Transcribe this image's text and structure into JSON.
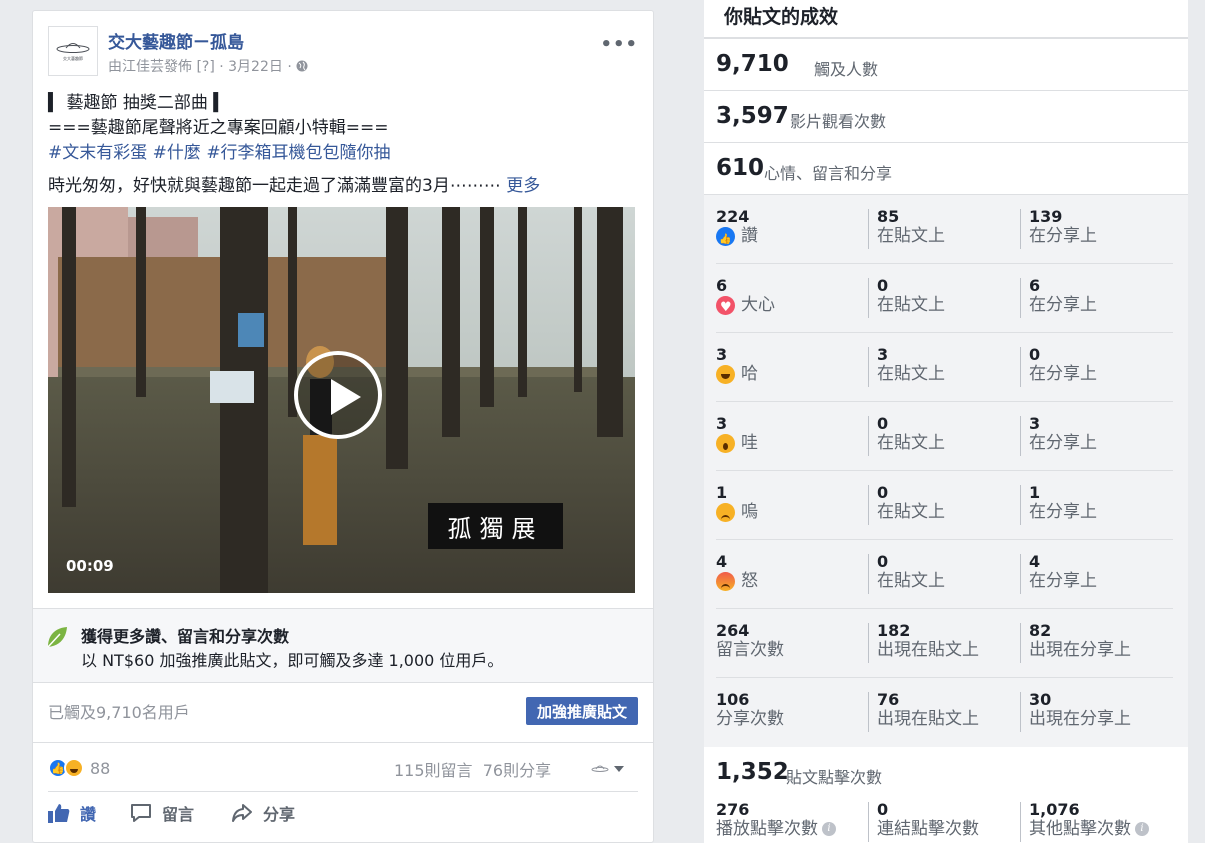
{
  "post": {
    "page_name": "交大藝趣節ㄧ孤島",
    "avatar_text": "交大藝趣節",
    "meta": "由江佳芸發佈 [?] · 3月22日 · ",
    "line1": "▍ 藝趣節 抽獎二部曲 ▍",
    "line2": "===藝趣節尾聲將近之專案回顧小特輯===",
    "hashtags": [
      "#文末有彩蛋",
      "#什麼",
      "#行李箱耳機包包隨你抽"
    ],
    "line4": "時光匆匆，好快就與藝趣節一起走過了滿滿豐富的3月⋯⋯⋯ ",
    "see_more": "更多",
    "video": {
      "time": "00:09",
      "caption": "孤獨展"
    },
    "boost_tip": {
      "title": "獲得更多讚、留言和分享次數",
      "text": "以 NT$60 加強推廣此貼文，即可觸及多達 1,000 位用戶。"
    },
    "reached": "已觸及9,710名用戶",
    "boost_button": "加強推廣貼文",
    "reaction_count": "88",
    "comments": "115則留言",
    "shares": "76則分享",
    "actions": {
      "like": "讚",
      "comment": "留言",
      "share": "分享"
    }
  },
  "insights": {
    "title": "你貼文的成效",
    "metrics": [
      {
        "num": "9,710",
        "label": "觸及人數"
      },
      {
        "num": "3,597",
        "label": "影片觀看次數"
      },
      {
        "num": "610",
        "label": "心情、留言和分享"
      }
    ],
    "rows": [
      {
        "icon": "like-icon",
        "total": "224",
        "label": "讚",
        "post": "85",
        "post_label": "在貼文上",
        "share": "139",
        "share_label": "在分享上"
      },
      {
        "icon": "love-icon",
        "total": "6",
        "label": "大心",
        "post": "0",
        "post_label": "在貼文上",
        "share": "6",
        "share_label": "在分享上"
      },
      {
        "icon": "haha-icon",
        "total": "3",
        "label": "哈",
        "post": "3",
        "post_label": "在貼文上",
        "share": "0",
        "share_label": "在分享上"
      },
      {
        "icon": "wow-icon",
        "total": "3",
        "label": "哇",
        "post": "0",
        "post_label": "在貼文上",
        "share": "3",
        "share_label": "在分享上"
      },
      {
        "icon": "sad-icon",
        "total": "1",
        "label": "嗚",
        "post": "0",
        "post_label": "在貼文上",
        "share": "1",
        "share_label": "在分享上"
      },
      {
        "icon": "angry-icon",
        "total": "4",
        "label": "怒",
        "post": "0",
        "post_label": "在貼文上",
        "share": "4",
        "share_label": "在分享上"
      },
      {
        "icon": "",
        "total": "264",
        "label": "留言次數",
        "post": "182",
        "post_label": "出現在貼文上",
        "share": "82",
        "share_label": "出現在分享上"
      },
      {
        "icon": "",
        "total": "106",
        "label": "分享次數",
        "post": "76",
        "post_label": "出現在貼文上",
        "share": "30",
        "share_label": "出現在分享上"
      }
    ],
    "clicks": {
      "num": "1,352",
      "label": "貼文點擊次數",
      "play": "276",
      "play_label": "播放點擊次數",
      "link": "0",
      "link_label": "連結點擊次數",
      "other": "1,076",
      "other_label": "其他點擊次數"
    }
  },
  "colors": {
    "link": "#365899",
    "button": "#4267b2",
    "page_bg": "#e9ebee"
  }
}
